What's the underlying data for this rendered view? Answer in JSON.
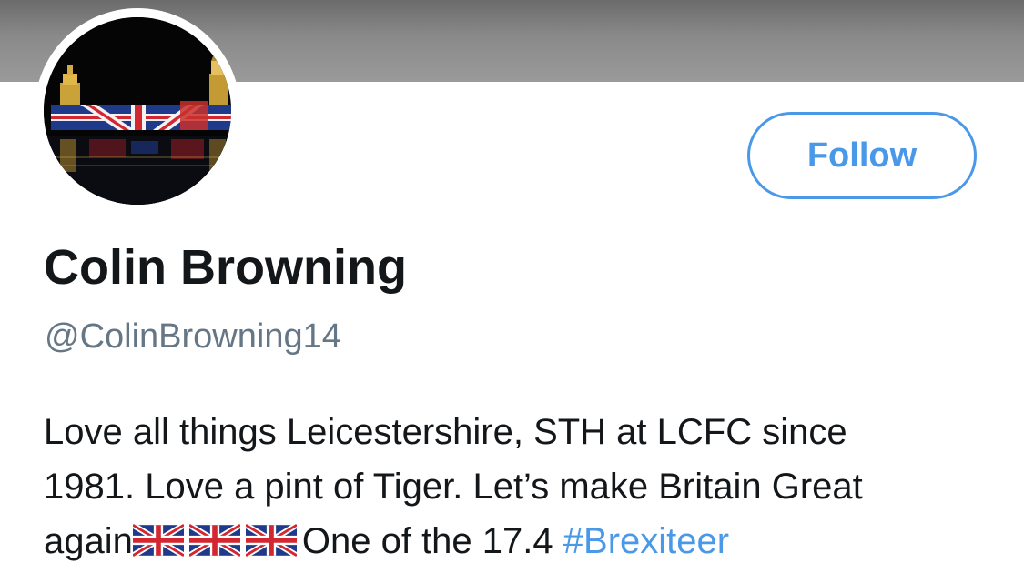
{
  "profile": {
    "name": "Colin Browning",
    "handle": "@ColinBrowning14",
    "follow_label": "Follow",
    "bio": {
      "line1": "Love all things Leicestershire, STH at LCFC since",
      "line2": "1981. Love a pint of Tiger. Let’s make Britain Great",
      "line3_start": "again",
      "line3_after_flags": "One of the 17.4",
      "hashtag": "#Brexiteer"
    },
    "flag_icon": "union-jack-flag-icon",
    "flag_count": 3
  },
  "colors": {
    "accent": "#4a99e9",
    "text": "#14171a",
    "secondary": "#657786",
    "banner": "#8a8a8a"
  }
}
